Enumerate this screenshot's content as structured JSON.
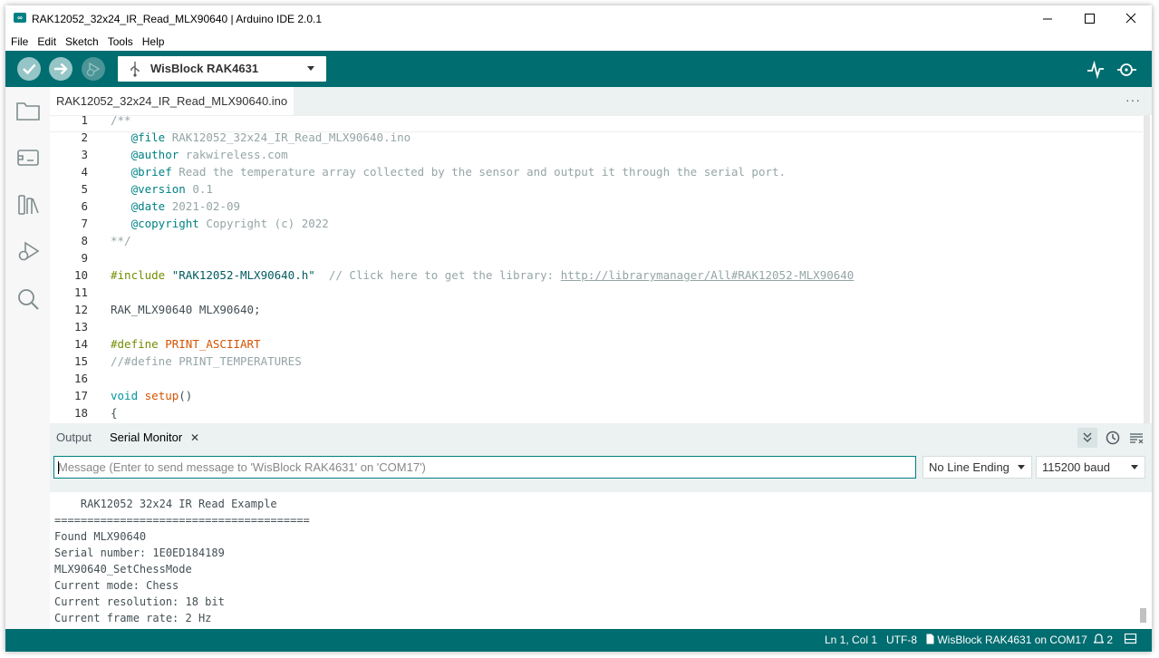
{
  "window": {
    "title": "RAK12052_32x24_IR_Read_MLX90640 | Arduino IDE 2.0.1",
    "app_icon": "∞",
    "controls": {
      "minimize": "—",
      "maximize": "☐",
      "close": "✕"
    }
  },
  "menu": [
    "File",
    "Edit",
    "Sketch",
    "Tools",
    "Help"
  ],
  "toolbar": {
    "verify_icon": "check-icon",
    "upload_icon": "arrow-right-icon",
    "debug_icon": "debug-icon",
    "board": "WisBlock RAK4631",
    "serial_plotter_icon": "plotter-icon",
    "serial_monitor_icon": "serial-monitor-icon"
  },
  "sidebar": [
    "folder-icon",
    "board-icon",
    "library-icon",
    "debug-icon",
    "search-icon"
  ],
  "editor": {
    "tab_label": "RAK12052_32x24_IR_Read_MLX90640.ino",
    "more_label": "···"
  },
  "code_lines": [
    {
      "n": "1",
      "segs": [
        {
          "t": "/**",
          "c": "c"
        }
      ]
    },
    {
      "n": "2",
      "segs": [
        {
          "t": "   ",
          "c": ""
        },
        {
          "t": "@file",
          "c": "tag"
        },
        {
          "t": " RAK12052_32x24_IR_Read_MLX90640.ino",
          "c": "c"
        }
      ]
    },
    {
      "n": "3",
      "segs": [
        {
          "t": "   ",
          "c": ""
        },
        {
          "t": "@author",
          "c": "tag"
        },
        {
          "t": " rakwireless.com",
          "c": "c"
        }
      ]
    },
    {
      "n": "4",
      "segs": [
        {
          "t": "   ",
          "c": ""
        },
        {
          "t": "@brief",
          "c": "tag"
        },
        {
          "t": " Read the temperature array collected by the sensor and output it through the serial port.",
          "c": "c"
        }
      ]
    },
    {
      "n": "5",
      "segs": [
        {
          "t": "   ",
          "c": ""
        },
        {
          "t": "@version",
          "c": "tag"
        },
        {
          "t": " 0.1",
          "c": "c"
        }
      ]
    },
    {
      "n": "6",
      "segs": [
        {
          "t": "   ",
          "c": ""
        },
        {
          "t": "@date",
          "c": "tag"
        },
        {
          "t": " 2021-02-09",
          "c": "c"
        }
      ]
    },
    {
      "n": "7",
      "segs": [
        {
          "t": "   ",
          "c": ""
        },
        {
          "t": "@copyright",
          "c": "tag"
        },
        {
          "t": " Copyright (c) 2022",
          "c": "c"
        }
      ]
    },
    {
      "n": "8",
      "segs": [
        {
          "t": "**/",
          "c": "c"
        }
      ]
    },
    {
      "n": "9",
      "segs": []
    },
    {
      "n": "10",
      "segs": [
        {
          "t": "#include",
          "c": "kw"
        },
        {
          "t": " \"RAK12052-MLX90640.h\"",
          "c": "str"
        },
        {
          "t": "  // Click here to get the library: ",
          "c": "c"
        },
        {
          "t": "http://librarymanager/All#RAK12052-MLX90640",
          "c": "link"
        }
      ]
    },
    {
      "n": "11",
      "segs": []
    },
    {
      "n": "12",
      "segs": [
        {
          "t": "RAK_MLX90640 MLX90640;",
          "c": ""
        }
      ]
    },
    {
      "n": "13",
      "segs": []
    },
    {
      "n": "14",
      "segs": [
        {
          "t": "#define",
          "c": "kw"
        },
        {
          "t": " PRINT_ASCIIART",
          "c": "fn"
        }
      ]
    },
    {
      "n": "15",
      "segs": [
        {
          "t": "//#define PRINT_TEMPERATURES",
          "c": "c"
        }
      ]
    },
    {
      "n": "16",
      "segs": []
    },
    {
      "n": "17",
      "segs": [
        {
          "t": "void",
          "c": "kw2"
        },
        {
          "t": " ",
          "c": ""
        },
        {
          "t": "setup",
          "c": "fn"
        },
        {
          "t": "()",
          "c": ""
        }
      ]
    },
    {
      "n": "18",
      "segs": [
        {
          "t": "{",
          "c": ""
        }
      ]
    }
  ],
  "panel": {
    "output_tab": "Output",
    "serial_tab": "Serial Monitor",
    "close_icon": "✕",
    "collapse_icon": "chevrons-down-icon",
    "timestamp_icon": "clock-icon",
    "clear_icon": "clear-output-icon",
    "message_placeholder": "Message (Enter to send message to 'WisBlock RAK4631' on 'COM17')",
    "line_ending": "No Line Ending",
    "baud": "115200 baud"
  },
  "serial_lines": [
    "    RAK12052 32x24 IR Read Example",
    "=======================================",
    "Found MLX90640",
    "Serial number: 1E0ED184189",
    "MLX90640_SetChessMode",
    "Current mode: Chess",
    "Current resolution: 18 bit",
    "Current frame rate: 2 Hz"
  ],
  "status": {
    "position": "Ln 1, Col 1",
    "encoding": "UTF-8",
    "board": "WisBlock RAK4631 on COM17",
    "notifications": "2"
  }
}
